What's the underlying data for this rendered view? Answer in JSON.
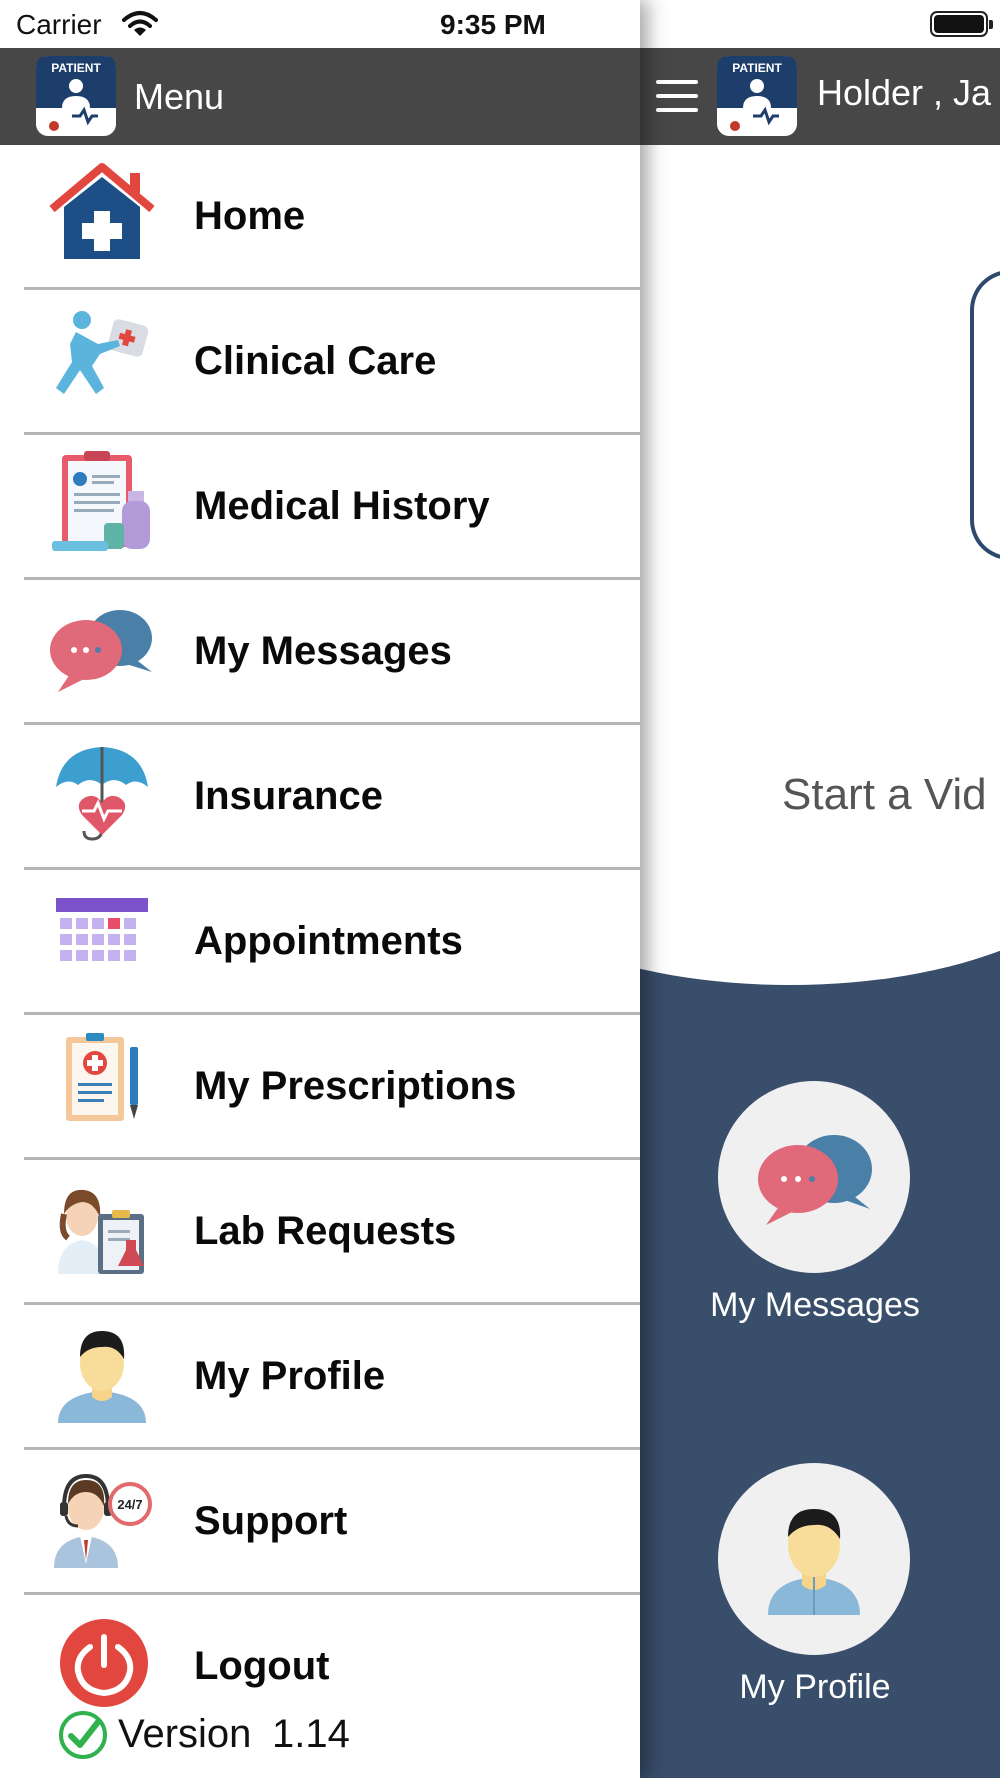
{
  "status_bar": {
    "carrier": "Carrier",
    "time": "9:35 PM"
  },
  "drawer": {
    "title": "Menu",
    "logo_text": "PATIENT",
    "items": [
      {
        "label": "Home",
        "icon": "home-medical-icon"
      },
      {
        "label": "Clinical Care",
        "icon": "clinical-care-icon"
      },
      {
        "label": "Medical History",
        "icon": "medical-history-icon"
      },
      {
        "label": "My Messages",
        "icon": "messages-icon"
      },
      {
        "label": "Insurance",
        "icon": "insurance-umbrella-icon"
      },
      {
        "label": "Appointments",
        "icon": "calendar-icon"
      },
      {
        "label": "My Prescriptions",
        "icon": "prescription-icon"
      },
      {
        "label": "Lab Requests",
        "icon": "lab-requests-icon"
      },
      {
        "label": "My Profile",
        "icon": "profile-icon"
      },
      {
        "label": "Support",
        "icon": "support-agent-icon"
      },
      {
        "label": "Logout",
        "icon": "power-icon"
      }
    ],
    "version_label": "Version",
    "version_number": "1.14"
  },
  "main": {
    "header_title": "Holder ,  Ja",
    "start_video_text": "Start a Vid",
    "tiles": [
      {
        "label": "My Messages",
        "icon": "messages-icon"
      },
      {
        "label": "My Profile",
        "icon": "profile-icon"
      }
    ]
  },
  "colors": {
    "header_bg": "#474747",
    "main_blue": "#384e6a",
    "logout_red": "#e2473f",
    "check_green": "#2fb24d"
  }
}
